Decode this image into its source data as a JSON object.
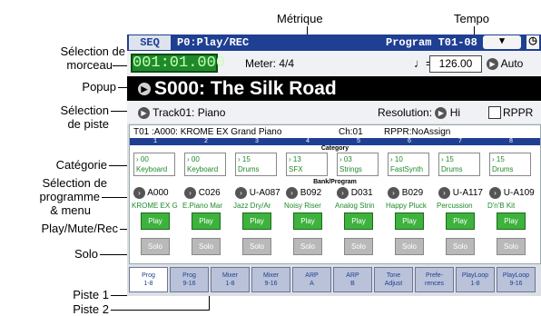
{
  "callouts": {
    "metrique": "Métrique",
    "tempo": "Tempo",
    "selection_morceau_1": "Sélection de",
    "selection_morceau_2": "morceau",
    "popup": "Popup",
    "selection_piste_1": "Sélection",
    "selection_piste_2": "de piste",
    "categorie": "Catégorie",
    "selection_programme_1": "Sélection de",
    "selection_programme_2": "programme",
    "selection_programme_3": "& menu",
    "play_mute_rec": "Play/Mute/Rec",
    "solo": "Solo",
    "piste1": "Piste 1",
    "piste2": "Piste 2"
  },
  "titlebar": {
    "mode": "SEQ",
    "page": "P0:Play/REC",
    "title": "Program T01-08",
    "menu": "▾"
  },
  "location": "001:01.000",
  "meter": "Meter: 4/4",
  "tempo": {
    "note": "♩=",
    "value": "126.00",
    "auto": "Auto"
  },
  "song": {
    "name": "S000: The Silk Road"
  },
  "track_select": "Track01: Piano",
  "resolution": "Resolution:",
  "resolution_value": "Hi",
  "rppr": "RPPR",
  "info": {
    "t01": "T01 :A000: KROME EX Grand Piano",
    "ch": "Ch:01",
    "rppr": "RPPR:NoAssign"
  },
  "category_header": "Category",
  "bank_header": "Bank/Program",
  "tracks": [
    {
      "num": "1",
      "cat_num": "00",
      "cat_name": "Keyboard",
      "prog": "A000",
      "pname": "KROME EX G",
      "play": "Play",
      "solo": "Solo"
    },
    {
      "num": "2",
      "cat_num": "00",
      "cat_name": "Keyboard",
      "prog": "C026",
      "pname": "E.Piano Mar",
      "play": "Play",
      "solo": "Solo"
    },
    {
      "num": "3",
      "cat_num": "15",
      "cat_name": "Drums",
      "prog": "U-A087",
      "pname": "Jazz Dry/Ar",
      "play": "Play",
      "solo": "Solo"
    },
    {
      "num": "4",
      "cat_num": "13",
      "cat_name": "SFX",
      "prog": "B092",
      "pname": "Noisy Riser",
      "play": "Play",
      "solo": "Solo"
    },
    {
      "num": "5",
      "cat_num": "03",
      "cat_name": "Strings",
      "prog": "D031",
      "pname": "Analog Strin",
      "play": "Play",
      "solo": "Solo"
    },
    {
      "num": "6",
      "cat_num": "10",
      "cat_name": "FastSynth",
      "prog": "B029",
      "pname": "Happy Pluck",
      "play": "Play",
      "solo": "Solo"
    },
    {
      "num": "7",
      "cat_num": "15",
      "cat_name": "Drums",
      "prog": "U-A117",
      "pname": "Percussion",
      "play": "Play",
      "solo": "Solo"
    },
    {
      "num": "8",
      "cat_num": "15",
      "cat_name": "Drums",
      "prog": "U-A109",
      "pname": "D'n'B Kit",
      "play": "Play",
      "solo": "Solo"
    }
  ],
  "tabs": [
    {
      "l1": "Prog",
      "l2": "1-8"
    },
    {
      "l1": "Prog",
      "l2": "9-16"
    },
    {
      "l1": "Mixer",
      "l2": "1-8"
    },
    {
      "l1": "Mixer",
      "l2": "9-16"
    },
    {
      "l1": "ARP",
      "l2": "A"
    },
    {
      "l1": "ARP",
      "l2": "B"
    },
    {
      "l1": "Tone",
      "l2": "Adjust"
    },
    {
      "l1": "Prefe-",
      "l2": "rences"
    },
    {
      "l1": "PlayLoop",
      "l2": "1-8"
    },
    {
      "l1": "PlayLoop",
      "l2": "9-16"
    }
  ]
}
